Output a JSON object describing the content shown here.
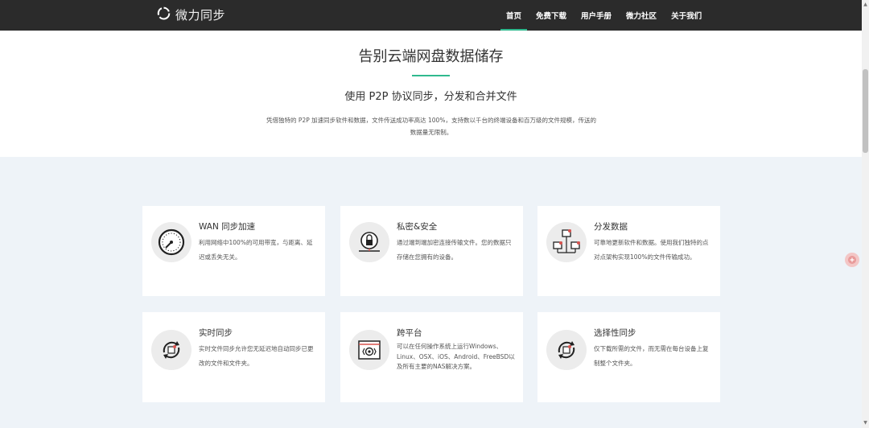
{
  "header": {
    "logo_text": "微力同步",
    "nav": [
      {
        "label": "首页",
        "active": true
      },
      {
        "label": "免费下载"
      },
      {
        "label": "用户手册"
      },
      {
        "label": "微力社区"
      },
      {
        "label": "关于我们"
      }
    ]
  },
  "hero": {
    "title": "告别云端网盘数据储存",
    "subtitle": "使用 P2P 协议同步，分发和合并文件",
    "desc_line1": "凭借独特的 P2P 加速同步软件和数据，文件传送成功率高达 100%，支持数以千台的终端设备和百万级的文件规模，传送的",
    "desc_line2": "数据量无限制。"
  },
  "features": [
    {
      "title": "WAN 同步加速",
      "desc": "利用网络中100%的可用带宽，与距离、延迟或丢失无关。",
      "icon": "speedometer-icon"
    },
    {
      "title": "私密&安全",
      "desc": "通过端到端加密连接传输文件。您的数据只存储在您拥有的设备。",
      "icon": "lock-icon"
    },
    {
      "title": "分发数据",
      "desc": "可靠地更新软件和数据。使用我们独特的点对点架构实现100%的文件传输成功。",
      "icon": "network-icon"
    },
    {
      "title": "实时同步",
      "desc": "实时文件同步允许您无延迟地自动同步已更改的文件和文件夹。",
      "icon": "sync-icon"
    },
    {
      "title": "跨平台",
      "desc": "可以在任何操作系统上运行Windows、Linux、OSX、iOS、Android、FreeBSD以及所有主要的NAS解决方案。",
      "icon": "platform-icon"
    },
    {
      "title": "选择性同步",
      "desc": "仅下载所需的文件，而无需在每台设备上复制整个文件夹。",
      "icon": "selective-sync-icon"
    }
  ],
  "colors": {
    "accent": "#30b98e",
    "topbar": "#2b2b2b",
    "section_bg": "#eef3f8"
  }
}
